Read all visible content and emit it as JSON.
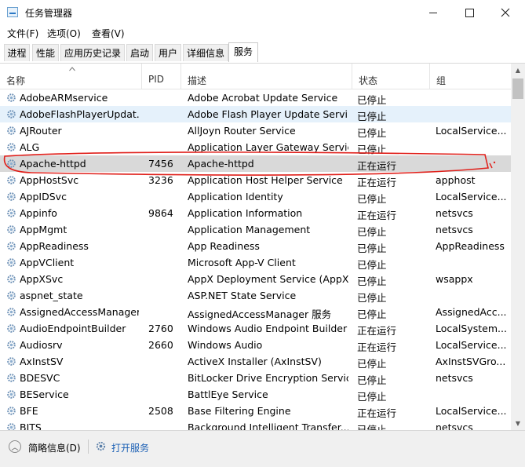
{
  "window": {
    "title": "任务管理器"
  },
  "menu": [
    "文件(F)",
    "选项(O)",
    "查看(V)"
  ],
  "tabs": [
    "进程",
    "性能",
    "应用历史记录",
    "启动",
    "用户",
    "详细信息",
    "服务"
  ],
  "active_tab": 6,
  "columns": {
    "name": "名称",
    "pid": "PID",
    "desc": "描述",
    "status": "状态",
    "group": "组"
  },
  "rows": [
    {
      "name": "AdobeARMservice",
      "pid": "",
      "desc": "Adobe Acrobat Update Service",
      "status": "已停止",
      "group": ""
    },
    {
      "name": "AdobeFlashPlayerUpdat...",
      "pid": "",
      "desc": "Adobe Flash Player Update Servi...",
      "status": "已停止",
      "group": ""
    },
    {
      "name": "AJRouter",
      "pid": "",
      "desc": "AllJoyn Router Service",
      "status": "已停止",
      "group": "LocalService..."
    },
    {
      "name": "ALG",
      "pid": "",
      "desc": "Application Layer Gateway Service",
      "status": "已停止",
      "group": ""
    },
    {
      "name": "Apache-httpd",
      "pid": "7456",
      "desc": "Apache-httpd",
      "status": "正在运行",
      "group": ""
    },
    {
      "name": "AppHostSvc",
      "pid": "3236",
      "desc": "Application Host Helper Service",
      "status": "正在运行",
      "group": "apphost"
    },
    {
      "name": "AppIDSvc",
      "pid": "",
      "desc": "Application Identity",
      "status": "已停止",
      "group": "LocalService..."
    },
    {
      "name": "Appinfo",
      "pid": "9864",
      "desc": "Application Information",
      "status": "正在运行",
      "group": "netsvcs"
    },
    {
      "name": "AppMgmt",
      "pid": "",
      "desc": "Application Management",
      "status": "已停止",
      "group": "netsvcs"
    },
    {
      "name": "AppReadiness",
      "pid": "",
      "desc": "App Readiness",
      "status": "已停止",
      "group": "AppReadiness"
    },
    {
      "name": "AppVClient",
      "pid": "",
      "desc": "Microsoft App-V Client",
      "status": "已停止",
      "group": ""
    },
    {
      "name": "AppXSvc",
      "pid": "",
      "desc": "AppX Deployment Service (AppX...",
      "status": "已停止",
      "group": "wsappx"
    },
    {
      "name": "aspnet_state",
      "pid": "",
      "desc": "ASP.NET State Service",
      "status": "已停止",
      "group": ""
    },
    {
      "name": "AssignedAccessManager...",
      "pid": "",
      "desc": "AssignedAccessManager 服务",
      "status": "已停止",
      "group": "AssignedAcc..."
    },
    {
      "name": "AudioEndpointBuilder",
      "pid": "2760",
      "desc": "Windows Audio Endpoint Builder",
      "status": "正在运行",
      "group": "LocalSystem..."
    },
    {
      "name": "Audiosrv",
      "pid": "2660",
      "desc": "Windows Audio",
      "status": "正在运行",
      "group": "LocalService..."
    },
    {
      "name": "AxInstSV",
      "pid": "",
      "desc": "ActiveX Installer (AxInstSV)",
      "status": "已停止",
      "group": "AxInstSVGro..."
    },
    {
      "name": "BDESVC",
      "pid": "",
      "desc": "BitLocker Drive Encryption Service",
      "status": "已停止",
      "group": "netsvcs"
    },
    {
      "name": "BEService",
      "pid": "",
      "desc": "BattlEye Service",
      "status": "已停止",
      "group": ""
    },
    {
      "name": "BFE",
      "pid": "2508",
      "desc": "Base Filtering Engine",
      "status": "正在运行",
      "group": "LocalService..."
    },
    {
      "name": "BITS",
      "pid": "",
      "desc": "Background Intelligent Transfer...",
      "status": "已停止",
      "group": "netsvcs"
    }
  ],
  "selected_row": 1,
  "highlighted_row": 4,
  "footer": {
    "collapse_label": "简略信息(D)",
    "open_services": "打开服务"
  },
  "colors": {
    "selected": "#e5f1fb",
    "highlight": "#d9d9d9",
    "annotation": "#e0201b",
    "link": "#1a5fb4"
  }
}
